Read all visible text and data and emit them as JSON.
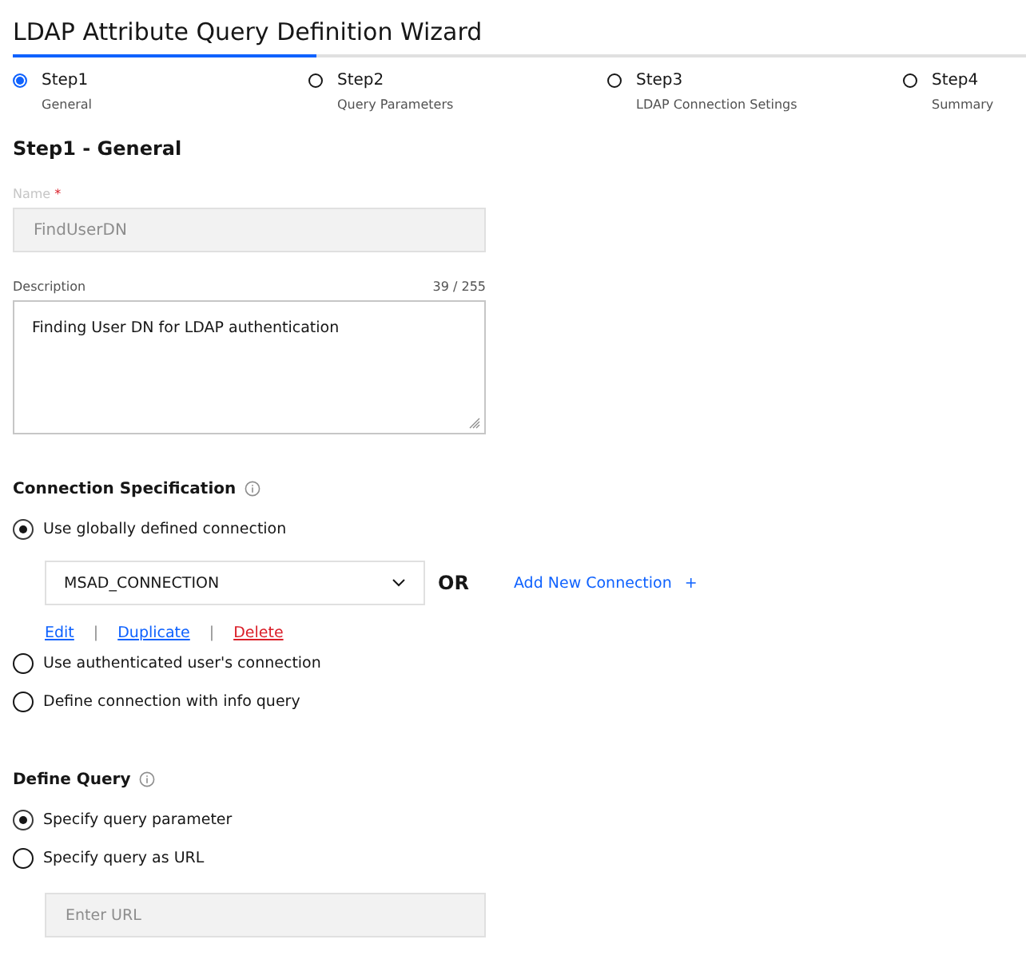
{
  "window": {
    "title": "LDAP Attribute Query Definition Wizard"
  },
  "progress": {
    "level": 0.3
  },
  "steps": [
    {
      "label": "Step1",
      "caption": "General",
      "selected": true
    },
    {
      "label": "Step2",
      "caption": "Query Parameters",
      "selected": false
    },
    {
      "label": "Step3",
      "caption": "LDAP Connection Setings",
      "selected": false
    },
    {
      "label": "Step4",
      "caption": "Summary",
      "selected": false
    }
  ],
  "section_title": "Step1 - General",
  "name_field": {
    "label": "Name",
    "required_mark": "*",
    "value": "FindUserDN",
    "disabled": true
  },
  "description_field": {
    "label": "Description",
    "counter": "39 / 255",
    "value": "Finding User DN for LDAP authentication"
  },
  "connection": {
    "heading": "Connection Specification",
    "options": [
      {
        "label": "Use globally defined connection",
        "selected": true
      },
      {
        "label": "Use authenticated user's connection",
        "selected": false
      },
      {
        "label": "Define connection with info query",
        "selected": false
      }
    ],
    "dropdown": {
      "value": "MSAD_CONNECTION"
    },
    "or_label": "OR",
    "add_link": "Add New Connection",
    "add_icon": "+",
    "actions": [
      {
        "label": "Edit",
        "kind": "normal"
      },
      {
        "label": "Duplicate",
        "kind": "normal"
      },
      {
        "label": "Delete",
        "kind": "danger"
      }
    ],
    "separators": [
      "|",
      "|"
    ]
  },
  "query": {
    "heading": "Define Query",
    "options": [
      {
        "label": "Specify query parameter",
        "selected": true
      },
      {
        "label": "Specify query as URL",
        "selected": false
      }
    ],
    "url_field": {
      "placeholder": "Enter URL",
      "disabled": true
    }
  }
}
